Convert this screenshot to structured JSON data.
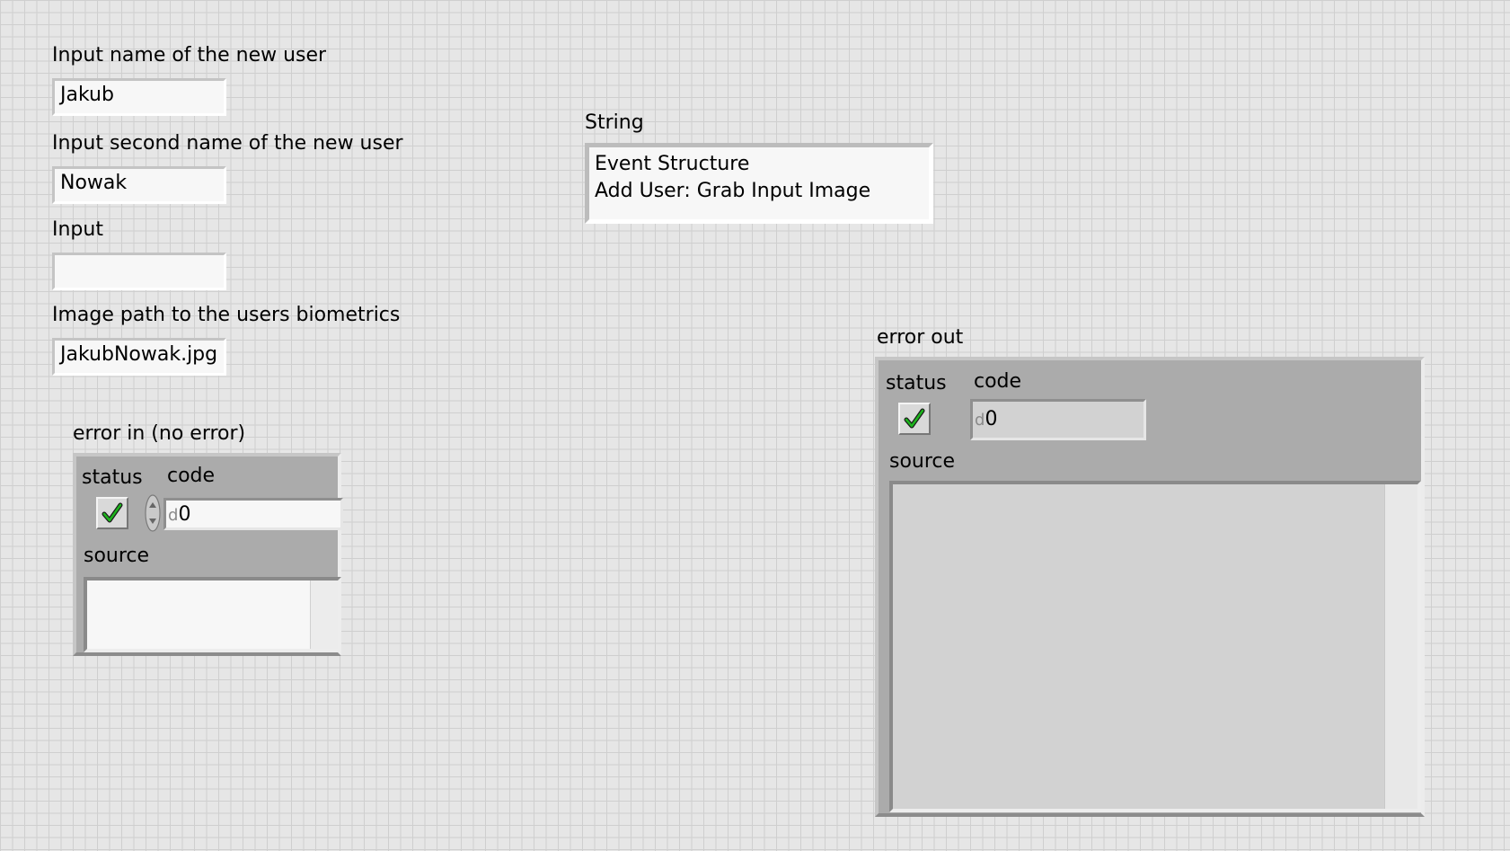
{
  "inputs": {
    "name_label": "Input name of the new user",
    "name_value": "Jakub",
    "second_name_label": "Input second name of the new user",
    "second_name_value": "Nowak",
    "input_label": "Input",
    "input_value": "",
    "image_path_label": "Image path to the users biometrics",
    "image_path_value": "JakubNowak.jpg"
  },
  "string_indicator": {
    "label": "String",
    "line1": "Event Structure",
    "line2": "Add User: Grab Input Image"
  },
  "error_in": {
    "label": "error in (no error)",
    "status_label": "status",
    "code_label": "code",
    "radix": "d",
    "code_value": "0",
    "source_label": "source",
    "source_value": ""
  },
  "error_out": {
    "label": "error out",
    "status_label": "status",
    "code_label": "code",
    "radix": "d",
    "code_value": "0",
    "source_label": "source",
    "source_value": ""
  },
  "icons": {
    "status_ok": "green-check-icon",
    "increment": "increment-decrement-icon"
  },
  "colors": {
    "check_green": "#1db31d",
    "panel_bg": "#e6e6e6",
    "cluster_bg": "#ababab"
  }
}
